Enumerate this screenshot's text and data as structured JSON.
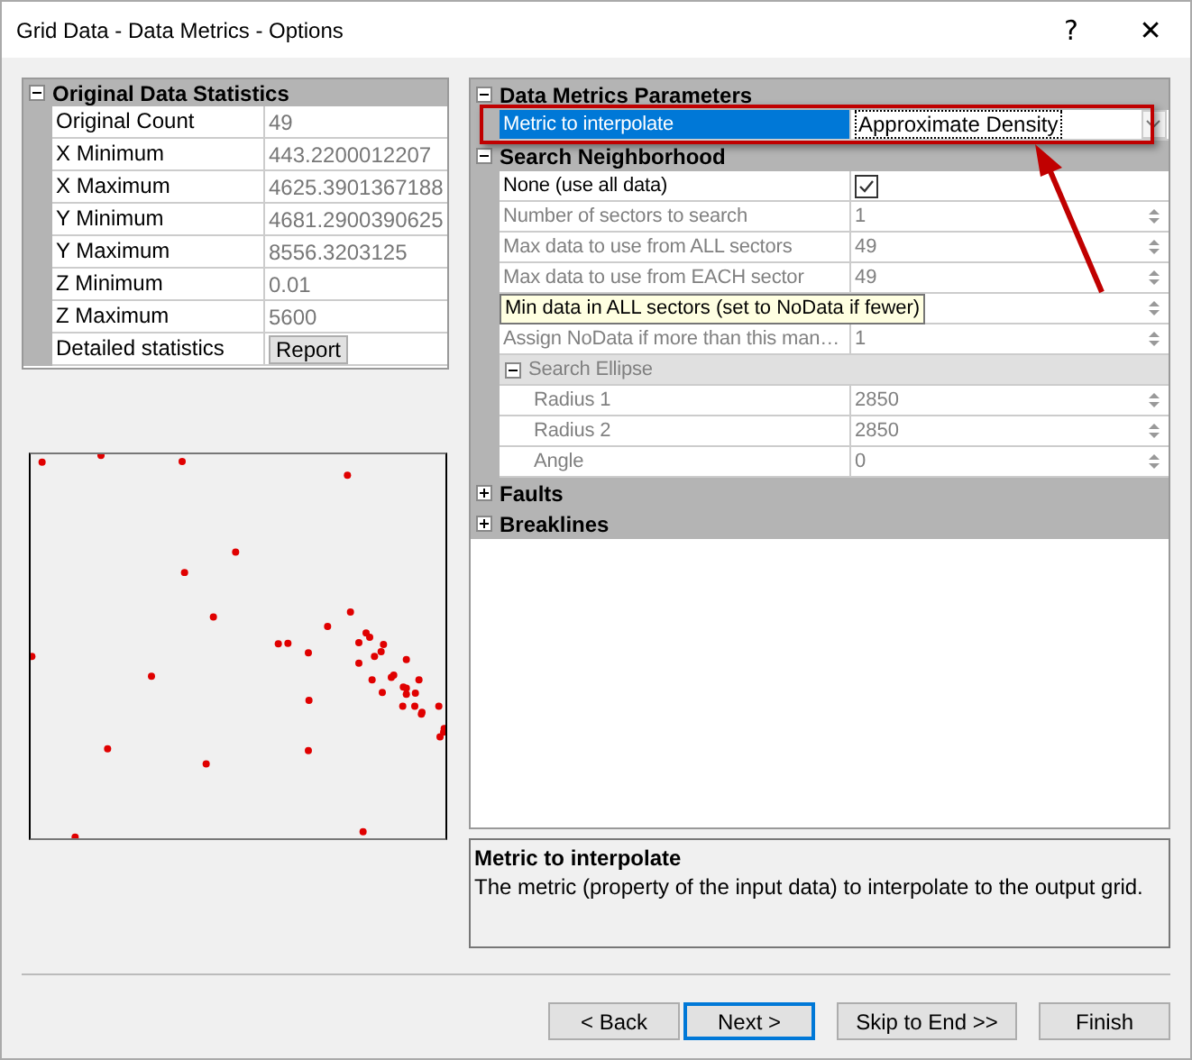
{
  "window": {
    "title": "Grid Data - Data Metrics - Options",
    "help": "?",
    "close": "✕"
  },
  "statistics": {
    "title": "Original Data Statistics",
    "expanded": true,
    "rows": [
      {
        "kind": "text",
        "label": "Original Count",
        "value": "49"
      },
      {
        "kind": "text",
        "label": "X Minimum",
        "value": "443.2200012207"
      },
      {
        "kind": "text",
        "label": "X Maximum",
        "value": "4625.3901367188"
      },
      {
        "kind": "text",
        "label": "Y Minimum",
        "value": "4681.2900390625"
      },
      {
        "kind": "text",
        "label": "Y Maximum",
        "value": "8556.3203125"
      },
      {
        "kind": "text",
        "label": "Z Minimum",
        "value": "0.01"
      },
      {
        "kind": "text",
        "label": "Z Maximum",
        "value": "5600"
      },
      {
        "kind": "button",
        "label": "Detailed statistics",
        "value": "Report"
      }
    ]
  },
  "parameters": [
    {
      "title": "Data Metrics Parameters",
      "expanded": true,
      "rows": [
        {
          "kind": "dropdown",
          "label": "Metric to interpolate",
          "value": "Approximate Density",
          "selected": true,
          "disabled": false
        }
      ]
    },
    {
      "title": "Search Neighborhood",
      "expanded": true,
      "rows": [
        {
          "kind": "checkbox",
          "label": "None (use all data)",
          "checked": true,
          "selected": false,
          "disabled": false
        },
        {
          "kind": "spin",
          "label": "Number of sectors to search",
          "value": "1",
          "selected": false,
          "disabled": true
        },
        {
          "kind": "spin",
          "label": "Max data to use from ALL sectors",
          "value": "49",
          "selected": false,
          "disabled": true
        },
        {
          "kind": "spin",
          "label": "Max data to use from EACH sector",
          "value": "49",
          "selected": false,
          "disabled": true
        },
        {
          "kind": "tooltip",
          "label": "Min data in ALL sectors (set to NoData if fewer)"
        },
        {
          "kind": "spin",
          "label": "Assign NoData if more than this man…",
          "value": "1",
          "selected": false,
          "disabled": true
        },
        {
          "kind": "group",
          "label": "Search Ellipse",
          "expanded": true,
          "disabled": true,
          "children": [
            {
              "kind": "spin",
              "label": "Radius 1",
              "value": "2850",
              "selected": false,
              "disabled": true
            },
            {
              "kind": "spin",
              "label": "Radius 2",
              "value": "2850",
              "selected": false,
              "disabled": true
            },
            {
              "kind": "spin",
              "label": "Angle",
              "value": "0",
              "selected": false,
              "disabled": true
            }
          ]
        }
      ]
    },
    {
      "title": "Faults",
      "expanded": false
    },
    {
      "title": "Breaklines",
      "expanded": false
    }
  ],
  "description": {
    "title": "Metric to interpolate",
    "text": "The metric (property of the input data) to interpolate to the output grid."
  },
  "buttons": [
    {
      "label": "< Back",
      "focused": false
    },
    {
      "label": "Next >",
      "focused": true
    },
    {
      "label": "Skip to End >>",
      "focused": false
    },
    {
      "label": "Finish",
      "focused": false
    }
  ]
}
